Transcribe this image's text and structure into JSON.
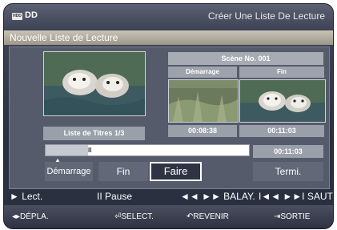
{
  "header": {
    "device_icon": "HDD",
    "device_label": "DD",
    "title": "Créer Une Liste De Lecture"
  },
  "subheader": {
    "title": "Nouvelle Liste de Lecture"
  },
  "preview": {
    "main_thumbnail": "otters-image",
    "title_list_label": "Liste de Titres 1/3"
  },
  "scene": {
    "header": "Scène No. 001",
    "start_label": "Démarrage",
    "end_label": "Fin",
    "start_time": "00:08:38",
    "end_time": "00:11:03",
    "start_thumbnail": "grass-image",
    "end_thumbnail": "otters-image"
  },
  "playback": {
    "progress_fraction": 0.21,
    "paused_indicator": "II",
    "current_time": "00:11:03"
  },
  "buttons": {
    "start": "Démarrage",
    "end": "Fin",
    "make": "Faire",
    "finish": "Termi.",
    "selected": "make"
  },
  "legend": {
    "play": "► Lect.",
    "pause": "II Pause",
    "scan": "◄◄ ►► BALAY.",
    "skip": "I◄◄ ►►I SAUTER"
  },
  "footer": {
    "move": "◂▸DÉPLA.",
    "select": "SELECT.",
    "back": "REVENIR",
    "exit": "SORTIE"
  },
  "colors": {
    "background": "#2a2f3f",
    "panel": "#555b6a",
    "label_box": "#9aa0aa",
    "selected_border": "#ffffff"
  }
}
